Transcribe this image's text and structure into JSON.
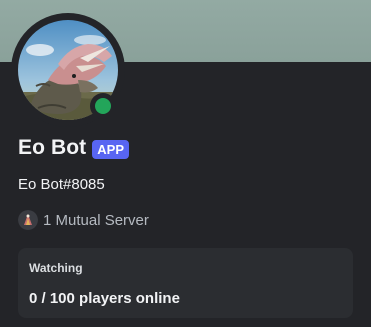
{
  "profile": {
    "display_name": "Eo Bot",
    "app_tag": "APP",
    "username": "Eo Bot#8085",
    "status": "online",
    "mutual_servers_label": "1 Mutual Server"
  },
  "activity": {
    "header": "Watching",
    "text": "0 / 100 players online"
  },
  "colors": {
    "banner": "#8fa7a0",
    "background": "#232428",
    "activity_bg": "#2b2d31",
    "status_online": "#23a55a",
    "app_tag_bg": "#5865f2"
  },
  "icons": {
    "avatar": "triceratops-avatar",
    "status": "online-status-dot",
    "mutual_server": "server-icon"
  }
}
